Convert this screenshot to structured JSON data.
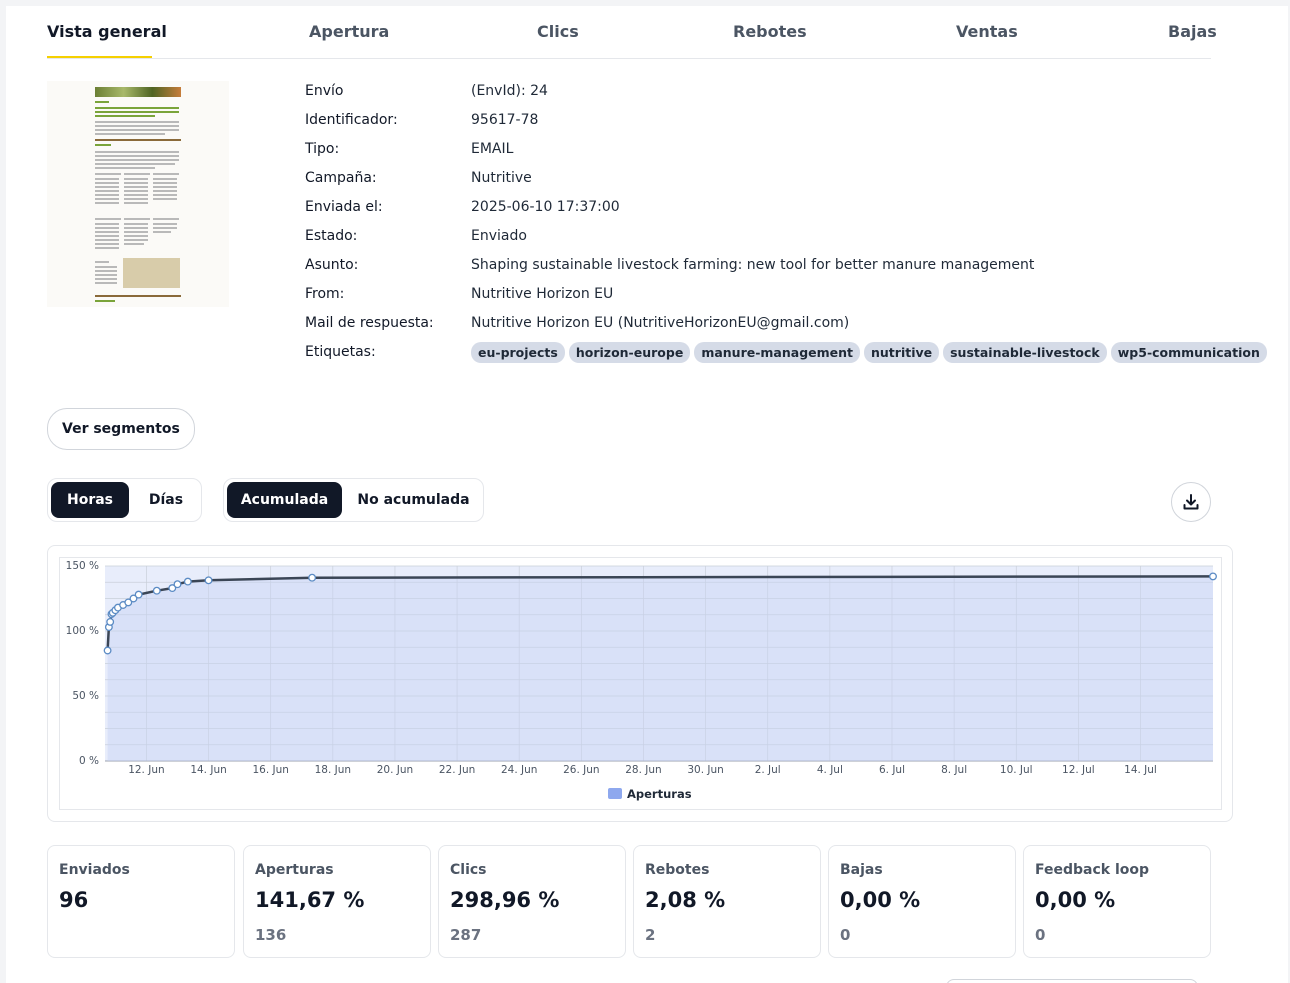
{
  "tabs": [
    {
      "label": "Vista general",
      "active": true
    },
    {
      "label": "Apertura"
    },
    {
      "label": "Clics"
    },
    {
      "label": "Rebotes"
    },
    {
      "label": "Ventas"
    },
    {
      "label": "Bajas"
    }
  ],
  "details": [
    {
      "label": "Envío",
      "value": "(EnvId): 24"
    },
    {
      "label": "Identificador:",
      "value": "95617-78"
    },
    {
      "label": "Tipo:",
      "value": "EMAIL"
    },
    {
      "label": "Campaña:",
      "value": "Nutritive"
    },
    {
      "label": "Enviada el:",
      "value": "2025-06-10 17:37:00"
    },
    {
      "label": "Estado:",
      "value": "Enviado"
    },
    {
      "label": "Asunto:",
      "value": "Shaping sustainable livestock farming: new tool for better manure management"
    },
    {
      "label": "From:",
      "value": "Nutritive Horizon EU"
    },
    {
      "label": "Mail de respuesta:",
      "value": "Nutritive Horizon EU (NutritiveHorizonEU@gmail.com)"
    },
    {
      "label": "Etiquetas:"
    }
  ],
  "tags": [
    "eu-projects",
    "horizon-europe",
    "manure-management",
    "nutritive",
    "sustainable-livestock",
    "wp5-communication"
  ],
  "buttons": {
    "segments": "Ver segmentos",
    "granularity": [
      "Horas",
      "Días"
    ],
    "granularity_selected": "Horas",
    "mode": [
      "Acumulada",
      "No acumulada"
    ],
    "mode_selected": "Acumulada"
  },
  "icons": {
    "download": "download-icon"
  },
  "colors": {
    "accent_underline": "#f5d000",
    "series_fill": "#e6ebfb",
    "series_line": "#3b4656",
    "legend": "#8ea8ee",
    "dark_button": "#111827"
  },
  "chart_data": {
    "type": "area",
    "series": [
      {
        "name": "Aperturas",
        "x": [
          "2025-06-10T18:00",
          "2025-06-10T19:00",
          "2025-06-10T20:00",
          "2025-06-10T21:00",
          "2025-06-10T22:00",
          "2025-06-11T00:00",
          "2025-06-11T02:00",
          "2025-06-11T06:00",
          "2025-06-11T10:00",
          "2025-06-11T14:00",
          "2025-06-11T18:00",
          "2025-06-12T08:00",
          "2025-06-12T20:00",
          "2025-06-13T00:00",
          "2025-06-13T08:00",
          "2025-06-14T00:00",
          "2025-06-17T08:00",
          "2025-07-16T08:00"
        ],
        "y": [
          85,
          103,
          107,
          113,
          114,
          116,
          118,
          120,
          122,
          125,
          128,
          131,
          133,
          136,
          138,
          139,
          141,
          142
        ]
      }
    ],
    "xticks": [
      "12. Jun",
      "14. Jun",
      "16. Jun",
      "18. Jun",
      "20. Jun",
      "22. Jun",
      "24. Jun",
      "26. Jun",
      "28. Jun",
      "30. Jun",
      "2. Jul",
      "4. Jul",
      "6. Jul",
      "8. Jul",
      "10. Jul",
      "12. Jul",
      "14. Jul"
    ],
    "yticks": [
      "0 %",
      "50 %",
      "100 %",
      "150 %"
    ],
    "ylim": [
      0,
      150
    ],
    "xlim": [
      "2025-06-10T16:00",
      "2025-07-16T08:00"
    ],
    "grid": true,
    "legend": "bottom-center"
  },
  "stats": [
    {
      "title": "Enviados",
      "value": "96",
      "sub": ""
    },
    {
      "title": "Aperturas",
      "value": "141,67 %",
      "sub": "136"
    },
    {
      "title": "Clics",
      "value": "298,96 %",
      "sub": "287"
    },
    {
      "title": "Rebotes",
      "value": "2,08 %",
      "sub": "2"
    },
    {
      "title": "Bajas",
      "value": "0,00 %",
      "sub": "0"
    },
    {
      "title": "Feedback loop",
      "value": "0,00 %",
      "sub": "0"
    }
  ]
}
